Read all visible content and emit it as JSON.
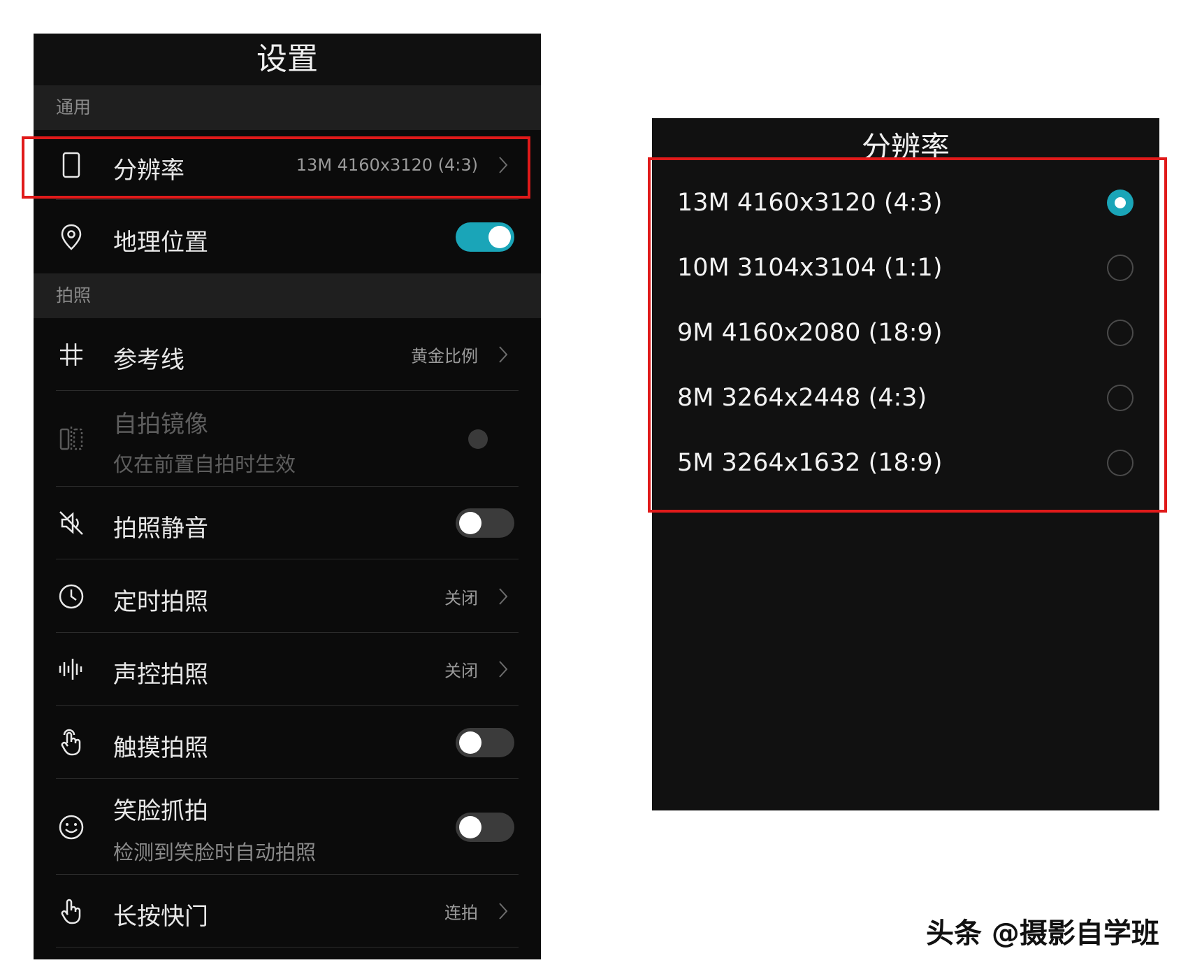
{
  "settings": {
    "title": "设置",
    "sections": {
      "general": "通用",
      "photo": "拍照"
    },
    "rows": {
      "resolution": {
        "label": "分辨率",
        "value": "13M 4160x3120 (4:3)"
      },
      "location": {
        "label": "地理位置",
        "toggle": true
      },
      "gridlines": {
        "label": "参考线",
        "value": "黄金比例"
      },
      "selfie_mirror": {
        "label": "自拍镜像",
        "sub": "仅在前置自拍时生效",
        "disabled": true
      },
      "mute": {
        "label": "拍照静音",
        "toggle": false
      },
      "timer": {
        "label": "定时拍照",
        "value": "关闭"
      },
      "voice": {
        "label": "声控拍照",
        "value": "关闭"
      },
      "touch": {
        "label": "触摸拍照",
        "toggle": false
      },
      "smile": {
        "label": "笑脸抓拍",
        "sub": "检测到笑脸时自动拍照",
        "toggle": false
      },
      "long_press": {
        "label": "长按快门",
        "value": "连拍"
      }
    }
  },
  "resolution_dialog": {
    "title": "分辨率",
    "options": [
      {
        "label": "13M 4160x3120 (4:3)",
        "selected": true
      },
      {
        "label": "10M 3104x3104 (1:1)",
        "selected": false
      },
      {
        "label": "9M 4160x2080 (18:9)",
        "selected": false
      },
      {
        "label": "8M 3264x2448 (4:3)",
        "selected": false
      },
      {
        "label": "5M 3264x1632 (18:9)",
        "selected": false
      }
    ]
  },
  "watermark": "头条 @摄影自学班",
  "colors": {
    "accent": "#1aa5b8",
    "highlight": "#e01a1a"
  },
  "icons": {
    "resolution": "phone-outline-icon",
    "location": "location-pin-icon",
    "gridlines": "grid-icon",
    "selfie_mirror": "mirror-icon",
    "mute": "speaker-muted-icon",
    "timer": "clock-icon",
    "voice": "soundwave-icon",
    "touch": "touch-hand-icon",
    "smile": "smiley-icon",
    "long_press": "hand-press-icon",
    "chevron": "chevron-right-icon"
  }
}
